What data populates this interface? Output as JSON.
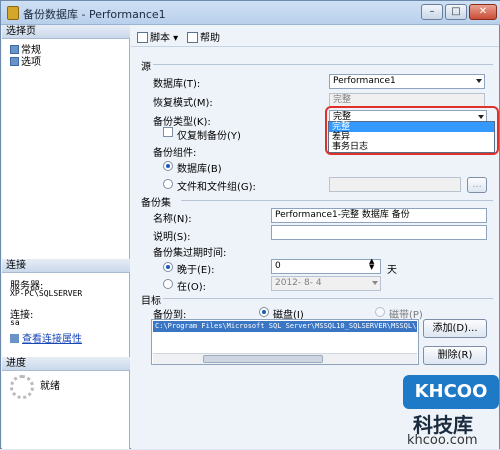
{
  "window": {
    "title": "备份数据库 - Performance1",
    "min": "–",
    "max": "□",
    "close": "✕"
  },
  "left": {
    "select_page": "选择页",
    "nav": [
      "常规",
      "选项"
    ],
    "connection": {
      "heading": "连接",
      "server_label": "服务器:",
      "server_value": "XP-PC\\SQLSERVER",
      "conn_label": "连接:",
      "conn_value": "sa",
      "view_link": "查看连接属性"
    },
    "progress": {
      "heading": "进度",
      "status": "就绪"
    }
  },
  "toolbar": {
    "script": "脚本",
    "help": "帮助"
  },
  "source": {
    "heading": "源",
    "db_label": "数据库(T):",
    "db_value": "Performance1",
    "recovery_label": "恢复模式(M):",
    "recovery_value": "完整",
    "type_label": "备份类型(K):",
    "type_value": "完整",
    "type_options": [
      "完整",
      "差异",
      "事务日志"
    ],
    "copy_only": "仅复制备份(Y)",
    "component_label": "备份组件:",
    "radio_db": "数据库(B)",
    "radio_files": "文件和文件组(G):",
    "browse": "..."
  },
  "backup_set": {
    "heading": "备份集",
    "name_label": "名称(N):",
    "name_value": "Performance1-完整 数据库 备份",
    "desc_label": "说明(S):",
    "desc_value": "",
    "expire_label": "备份集过期时间:",
    "after_label": "晚于(E):",
    "after_value": "0",
    "days": "天",
    "on_label": "在(O):",
    "on_value": "2012- 8- 4"
  },
  "destination": {
    "heading": "目标",
    "to_label": "备份到:",
    "disk": "磁盘(I)",
    "tape": "磁带(P)",
    "path": "C:\\Program Files\\Microsoft SQL Server\\MSSQL10_SQLSERVER\\MSSQL\\",
    "add": "添加(D)...",
    "remove": "删除(R)"
  },
  "watermark": {
    "logo": "KHCOO",
    "cn": "科技库",
    "url": "khcoo.com"
  }
}
